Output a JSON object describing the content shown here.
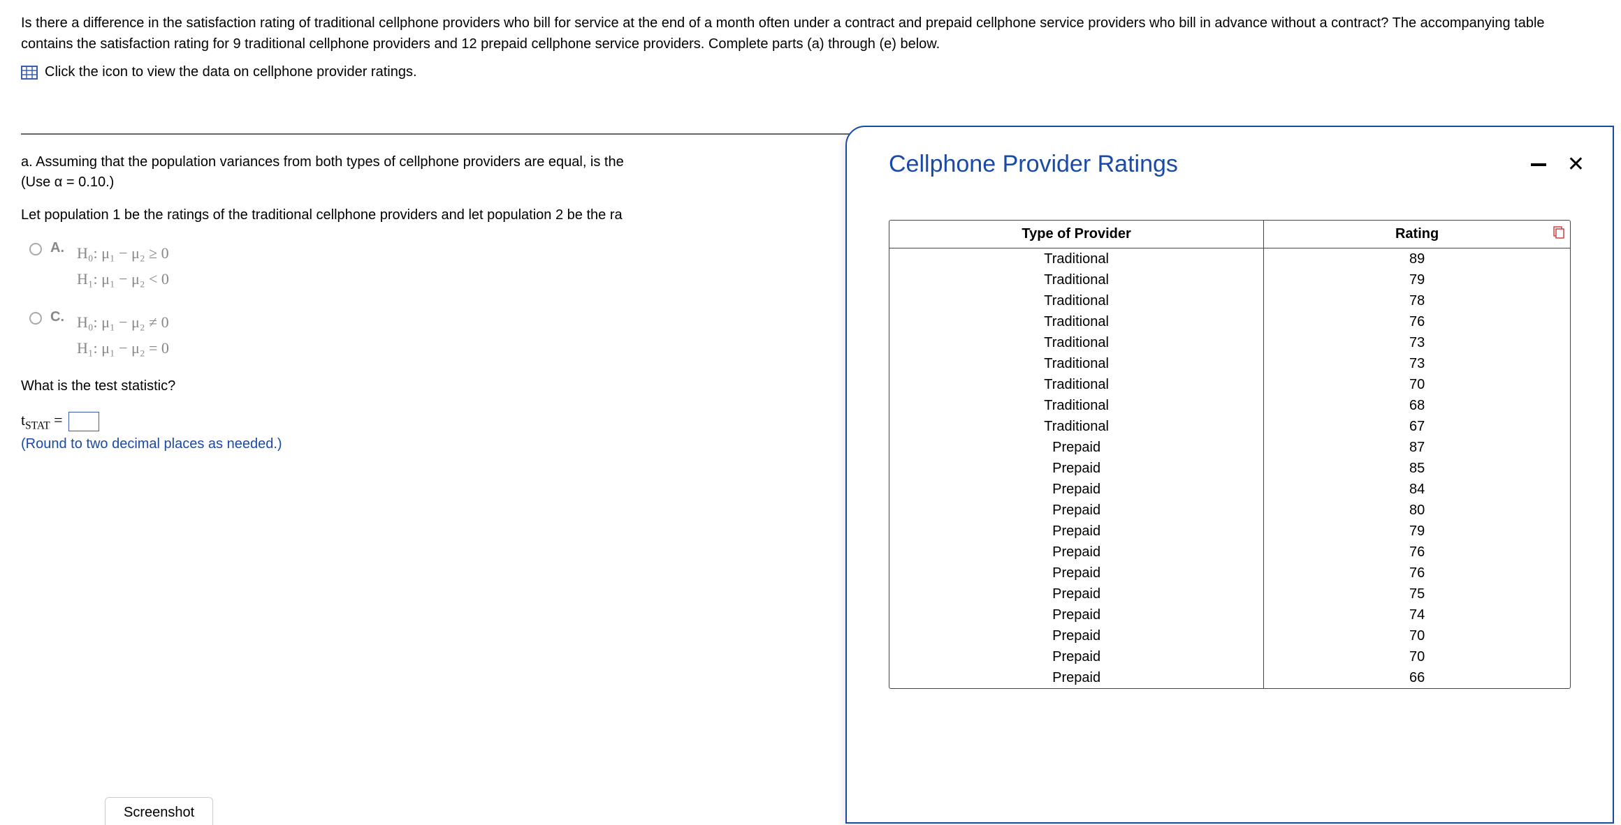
{
  "header": {
    "problem_text": "Is there a difference in the satisfaction rating of traditional cellphone providers who bill for service at the end of a month often under a contract and prepaid cellphone service providers who bill in advance without a contract? The accompanying table contains the satisfaction rating for 9 traditional cellphone providers and 12 prepaid cellphone service providers. Complete parts (a) through (e) below.",
    "link_text": "Click the icon to view the data on cellphone provider ratings."
  },
  "part_a": {
    "intro1": "a. Assuming that the population variances from both types of cellphone providers are equal, is the",
    "intro2": "(Use α = 0.10.)",
    "pop_line": "Let population 1 be the ratings of the traditional cellphone providers and let population 2 be the ra",
    "options": {
      "A": {
        "label": "A.",
        "h0": "H₀: μ₁ − μ₂ ≥ 0",
        "h1": "H₁: μ₁ − μ₂ < 0"
      },
      "C": {
        "label": "C.",
        "h0": "H₀: μ₁ − μ₂ ≠ 0",
        "h1": "H₁: μ₁ − μ₂ = 0"
      }
    },
    "tstat_q": "What is the test statistic?",
    "tstat_sym": "tSTAT =",
    "hint": "(Round to two decimal places as needed.)"
  },
  "modal": {
    "title": "Cellphone Provider Ratings",
    "col_type": "Type of Provider",
    "col_rating": "Rating",
    "rows": [
      {
        "type": "Traditional",
        "rating": "89"
      },
      {
        "type": "Traditional",
        "rating": "79"
      },
      {
        "type": "Traditional",
        "rating": "78"
      },
      {
        "type": "Traditional",
        "rating": "76"
      },
      {
        "type": "Traditional",
        "rating": "73"
      },
      {
        "type": "Traditional",
        "rating": "73"
      },
      {
        "type": "Traditional",
        "rating": "70"
      },
      {
        "type": "Traditional",
        "rating": "68"
      },
      {
        "type": "Traditional",
        "rating": "67"
      },
      {
        "type": "Prepaid",
        "rating": "87"
      },
      {
        "type": "Prepaid",
        "rating": "85"
      },
      {
        "type": "Prepaid",
        "rating": "84"
      },
      {
        "type": "Prepaid",
        "rating": "80"
      },
      {
        "type": "Prepaid",
        "rating": "79"
      },
      {
        "type": "Prepaid",
        "rating": "76"
      },
      {
        "type": "Prepaid",
        "rating": "76"
      },
      {
        "type": "Prepaid",
        "rating": "75"
      },
      {
        "type": "Prepaid",
        "rating": "74"
      },
      {
        "type": "Prepaid",
        "rating": "70"
      },
      {
        "type": "Prepaid",
        "rating": "70"
      },
      {
        "type": "Prepaid",
        "rating": "66"
      }
    ]
  },
  "footer": {
    "screenshot": "Screenshot"
  },
  "pill": "• • •"
}
